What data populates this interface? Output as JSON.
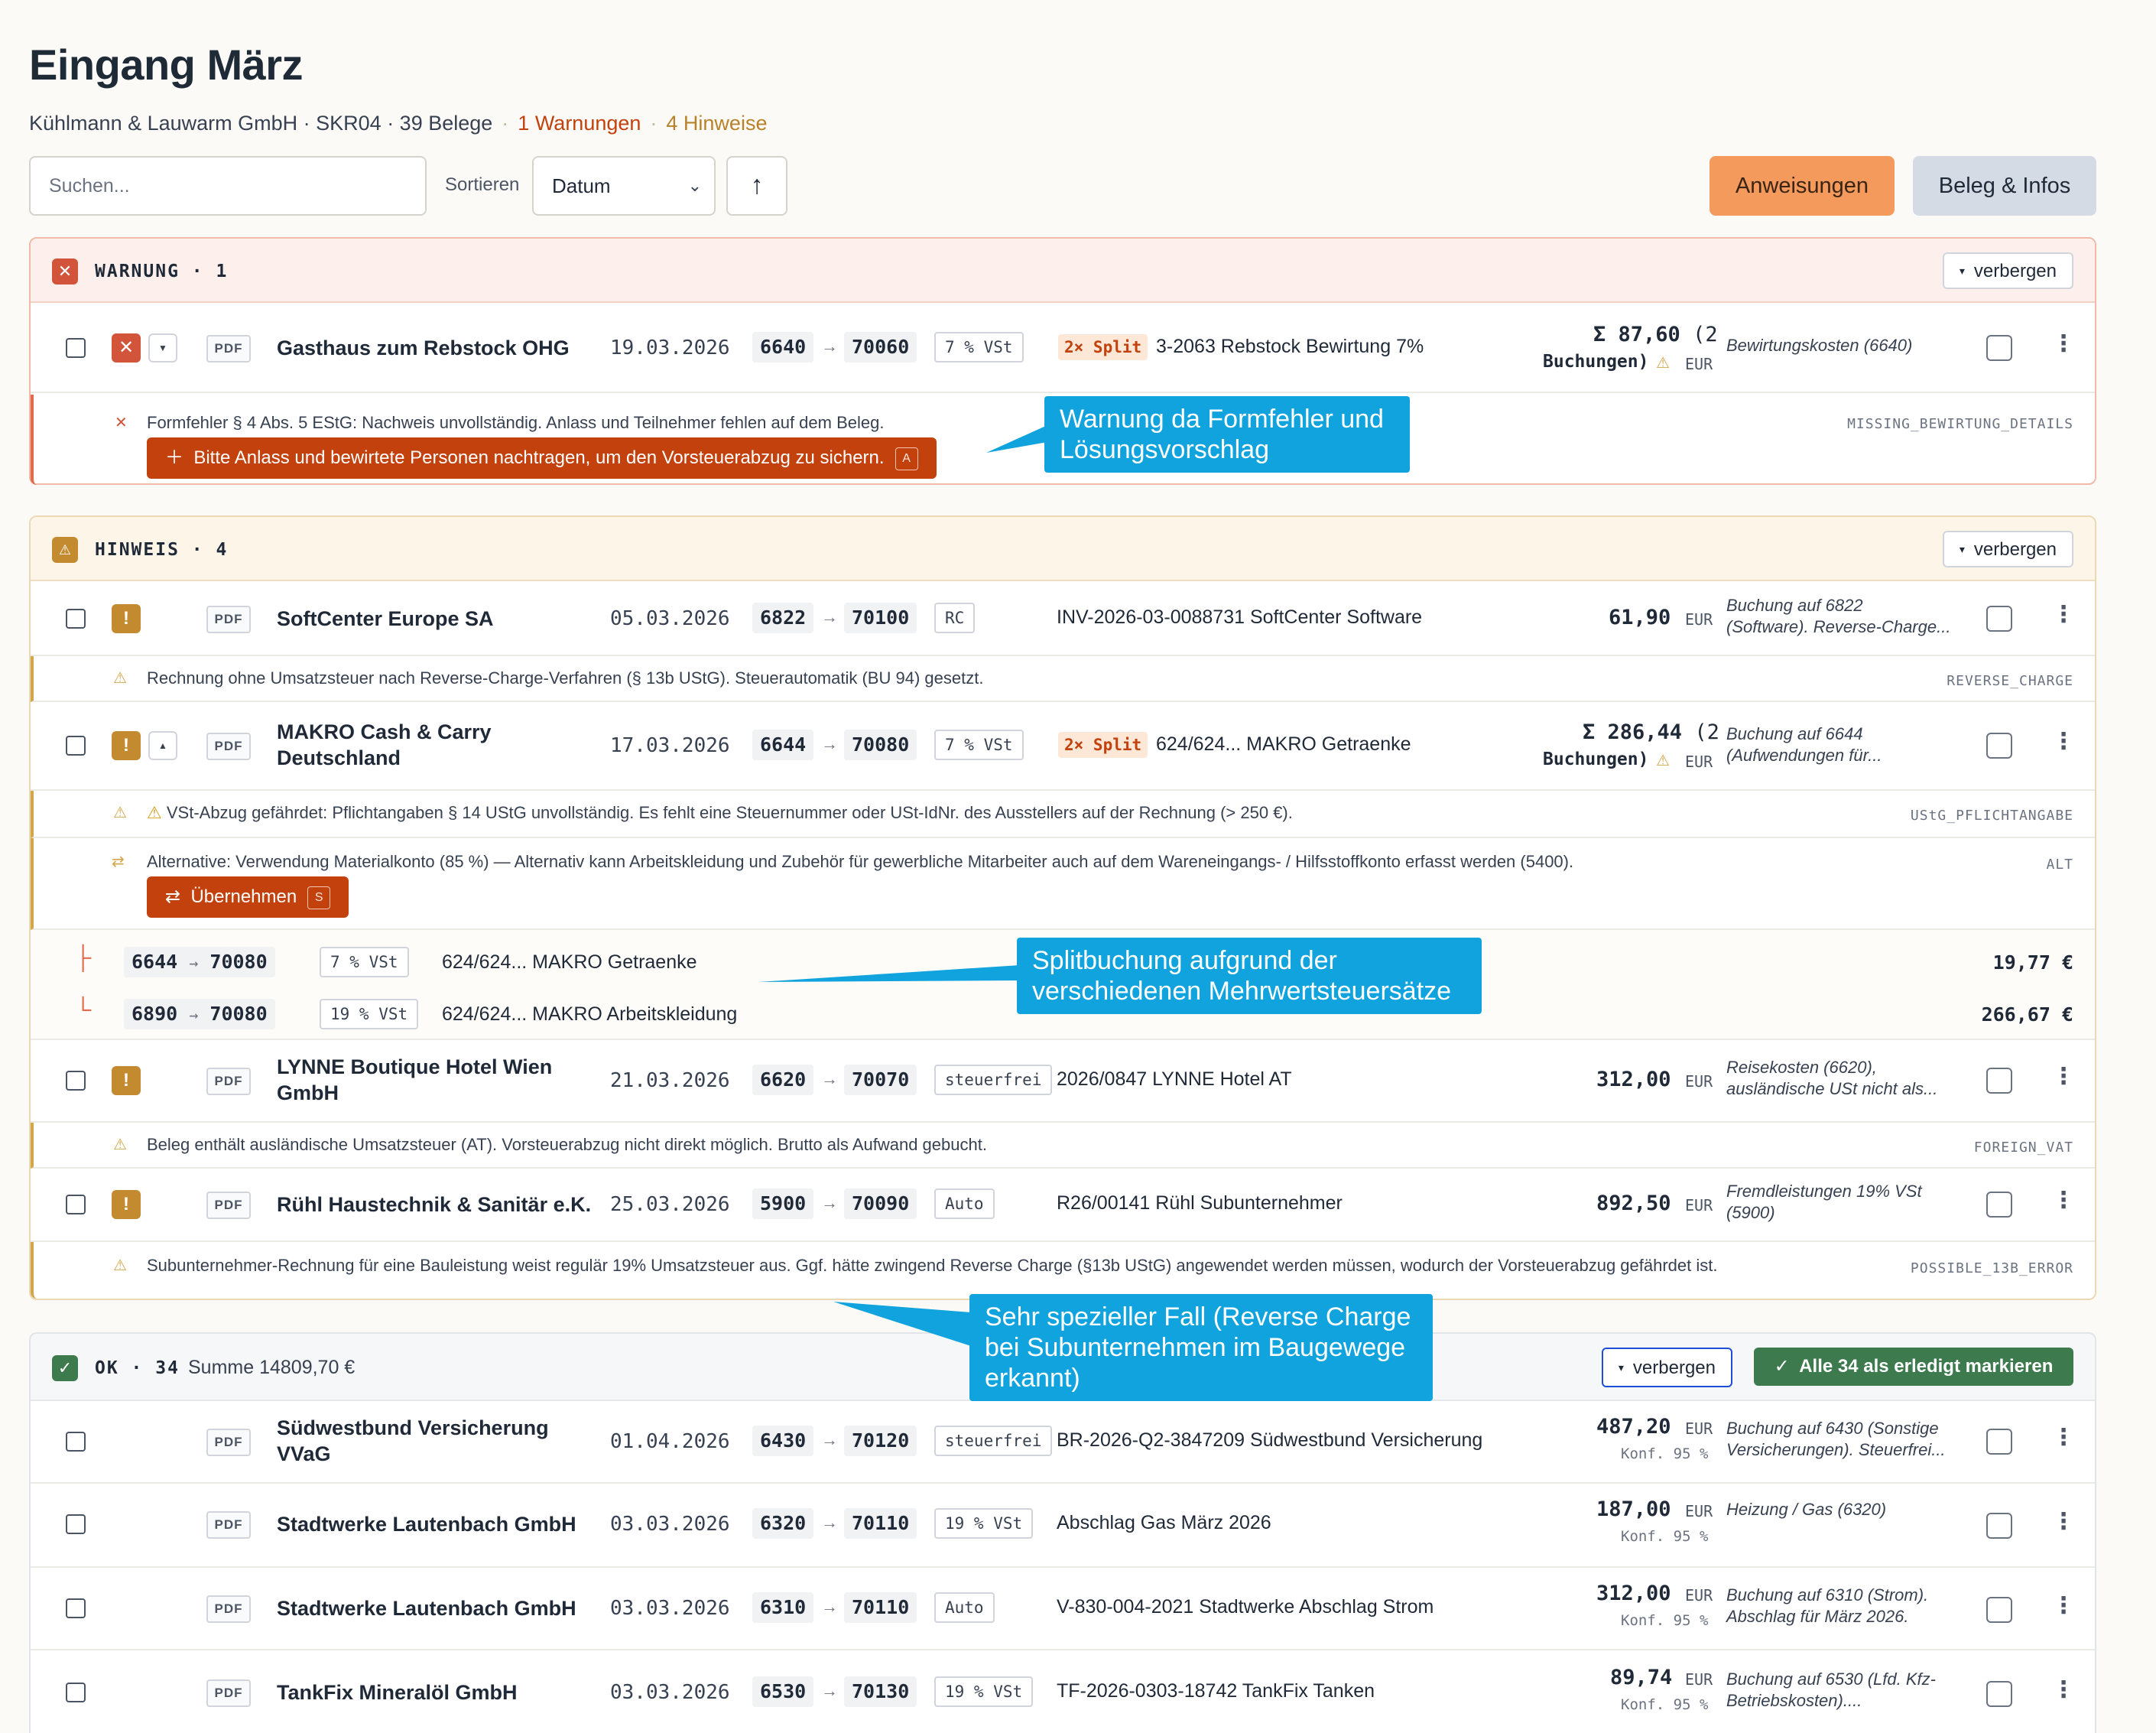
{
  "header": {
    "title": "Eingang März",
    "company": "Kühlmann & Lauwarm GmbH · SKR04 · 39 Belege",
    "warnings": "1 Warnungen",
    "hints": "4 Hinweise"
  },
  "toolbar": {
    "search_placeholder": "Suchen...",
    "sort_label": "Sortieren",
    "sort_value": "Datum",
    "sort_dir": "↑",
    "instructions_label": "Anweisungen",
    "receipt_info_label": "Beleg & Infos"
  },
  "sections": {
    "warning": {
      "label": "WARNUNG · 1",
      "hide": "verbergen"
    },
    "hint": {
      "label": "HINWEIS · 4",
      "hide": "verbergen"
    },
    "ok": {
      "label": "OK · 34",
      "sum": "Summe 14809,70 €",
      "hide": "verbergen",
      "mark_all": "Alle 34 als erledigt markieren"
    }
  },
  "rows": {
    "r1": {
      "vendor": "Gasthaus zum Rebstock OHG",
      "date": "19.03.2026",
      "from": "6640",
      "to": "70060",
      "tax": "7 % VSt",
      "split": "2× Split",
      "desc": "3-2063 Rebstock Bewirtung 7%",
      "amount": "Σ 87,60",
      "amount_extra": "(2",
      "amount_extra2": "Buchungen)",
      "cur": "EUR",
      "note": "Bewirtungskosten (6640)"
    },
    "r2": {
      "vendor": "SoftCenter Europe SA",
      "date": "05.03.2026",
      "from": "6822",
      "to": "70100",
      "tax": "RC",
      "desc": "INV-2026-03-0088731 SoftCenter Software",
      "amount": "61,90",
      "cur": "EUR",
      "note1": "Buchung auf 6822",
      "note2": "(Software). Reverse-Charge..."
    },
    "r3": {
      "vendor1": "MAKRO Cash & Carry",
      "vendor2": "Deutschland",
      "date": "17.03.2026",
      "from": "6644",
      "to": "70080",
      "tax": "7 % VSt",
      "split": "2× Split",
      "desc": "624/624... MAKRO Getraenke",
      "amount": "Σ 286,44",
      "amount_extra": "(2",
      "amount_extra2": "Buchungen)",
      "cur": "EUR",
      "note1": "Buchung auf 6644",
      "note2": "(Aufwendungen für..."
    },
    "r4": {
      "vendor1": "LYNNE Boutique Hotel Wien",
      "vendor2": "GmbH",
      "date": "21.03.2026",
      "from": "6620",
      "to": "70070",
      "tax": "steuerfrei",
      "desc": "2026/0847 LYNNE Hotel AT",
      "amount": "312,00",
      "cur": "EUR",
      "note1": "Reisekosten (6620),",
      "note2": "ausländische USt nicht als..."
    },
    "r5": {
      "vendor": "Rühl Haustechnik & Sanitär e.K.",
      "date": "25.03.2026",
      "from": "5900",
      "to": "70090",
      "tax": "Auto",
      "desc": "R26/00141 Rühl Subunternehmer",
      "amount": "892,50",
      "cur": "EUR",
      "note1": "Fremdleistungen 19% VSt",
      "note2": "(5900)"
    },
    "r6": {
      "vendor1": "Südwestbund Versicherung",
      "vendor2": "VVaG",
      "date": "01.04.2026",
      "from": "6430",
      "to": "70120",
      "tax": "steuerfrei",
      "desc": "BR-2026-Q2-3847209 Südwestbund Versicherung",
      "amount": "487,20",
      "cur": "EUR",
      "conf": "Konf. 95 %",
      "note1": "Buchung auf 6430 (Sonstige",
      "note2": "Versicherungen). Steuerfrei..."
    },
    "r7": {
      "vendor": "Stadtwerke Lautenbach GmbH",
      "date": "03.03.2026",
      "from": "6320",
      "to": "70110",
      "tax": "19 % VSt",
      "desc": "Abschlag Gas März 2026",
      "amount": "187,00",
      "cur": "EUR",
      "conf": "Konf. 95 %",
      "note1": "Heizung / Gas (6320)"
    },
    "r8": {
      "vendor": "Stadtwerke Lautenbach GmbH",
      "date": "03.03.2026",
      "from": "6310",
      "to": "70110",
      "tax": "Auto",
      "desc": "V-830-004-2021 Stadtwerke Abschlag Strom",
      "amount": "312,00",
      "cur": "EUR",
      "conf": "Konf. 95 %",
      "note1": "Buchung auf 6310 (Strom).",
      "note2": "Abschlag für März 2026."
    },
    "r9": {
      "vendor": "TankFix Mineralöl GmbH",
      "date": "03.03.2026",
      "from": "6530",
      "to": "70130",
      "tax": "19 % VSt",
      "desc": "TF-2026-0303-18742 TankFix Tanken",
      "amount": "89,74",
      "cur": "EUR",
      "conf": "Konf. 95 %",
      "note1": "Buchung auf 6530 (Lfd. Kfz-",
      "note2": "Betriebskosten)...."
    }
  },
  "messages": {
    "m1": {
      "text": "Formfehler § 4 Abs. 5 EStG: Nachweis unvollständig. Anlass und Teilnehmer fehlen auf dem Beleg.",
      "code": "MISSING_BEWIRTUNG_DETAILS",
      "fix": "Bitte Anlass und bewirtete Personen nachtragen, um den Vorsteuerabzug zu sichern.",
      "fix_key": "A"
    },
    "m2": {
      "text": "Rechnung ohne Umsatzsteuer nach Reverse-Charge-Verfahren (§ 13b UStG). Steuerautomatik (BU 94) gesetzt.",
      "code": "REVERSE_CHARGE"
    },
    "m3": {
      "text": "VSt-Abzug gefährdet: Pflichtangaben § 14 UStG unvollständig. Es fehlt eine Steuernummer oder USt-IdNr. des Ausstellers auf der Rechnung (> 250 €).",
      "code": "UStG_PFLICHTANGABE"
    },
    "m4": {
      "text": "Alternative: Verwendung Materialkonto (85 %) — Alternativ kann Arbeitskleidung und Zubehör für gewerbliche Mitarbeiter auch auf dem Wareneingangs- / Hilfsstoffkonto erfasst werden (5400).",
      "code": "ALT",
      "fix": "Übernehmen",
      "fix_key": "S"
    },
    "m5": {
      "text": "Beleg enthält ausländische Umsatzsteuer (AT). Vorsteuerabzug nicht direkt möglich. Brutto als Aufwand gebucht.",
      "code": "FOREIGN_VAT"
    },
    "m6": {
      "text": "Subunternehmer-Rechnung für eine Bauleistung weist regulär 19% Umsatzsteuer aus. Ggf. hätte zwingend Reverse Charge (§13b UStG) angewendet werden müssen, wodurch der Vorsteuerabzug gefährdet ist.",
      "code": "POSSIBLE_13B_ERROR"
    }
  },
  "splits": [
    {
      "from": "6644",
      "to": "70080",
      "tax": "7 % VSt",
      "desc": "624/624... MAKRO Getraenke",
      "amount": "19,77 €"
    },
    {
      "from": "6890",
      "to": "70080",
      "tax": "19 % VSt",
      "desc": "624/624... MAKRO Arbeitskleidung",
      "amount": "266,67 €"
    }
  ],
  "callouts": {
    "c1_l1": "Warnung da Formfehler und",
    "c1_l2": "Lösungsvorschlag",
    "c2_l1": "Splitbuchung aufgrund der",
    "c2_l2": "verschiedenen Mehrwertsteuersätze",
    "c3_l1": "Sehr spezieller Fall (Reverse Charge",
    "c3_l2": "bei Subunternehmen im Baugewege",
    "c3_l3": "erkannt)"
  },
  "common": {
    "pdf": "PDF",
    "arrow": "→",
    "hide_caret": "▾"
  },
  "colors": {
    "accent_orange": "#f49a5d",
    "warn_red": "#c2410c",
    "hint_gold": "#c38a30",
    "ok_green": "#3d7a4e",
    "callout_blue": "#10a3dd"
  }
}
